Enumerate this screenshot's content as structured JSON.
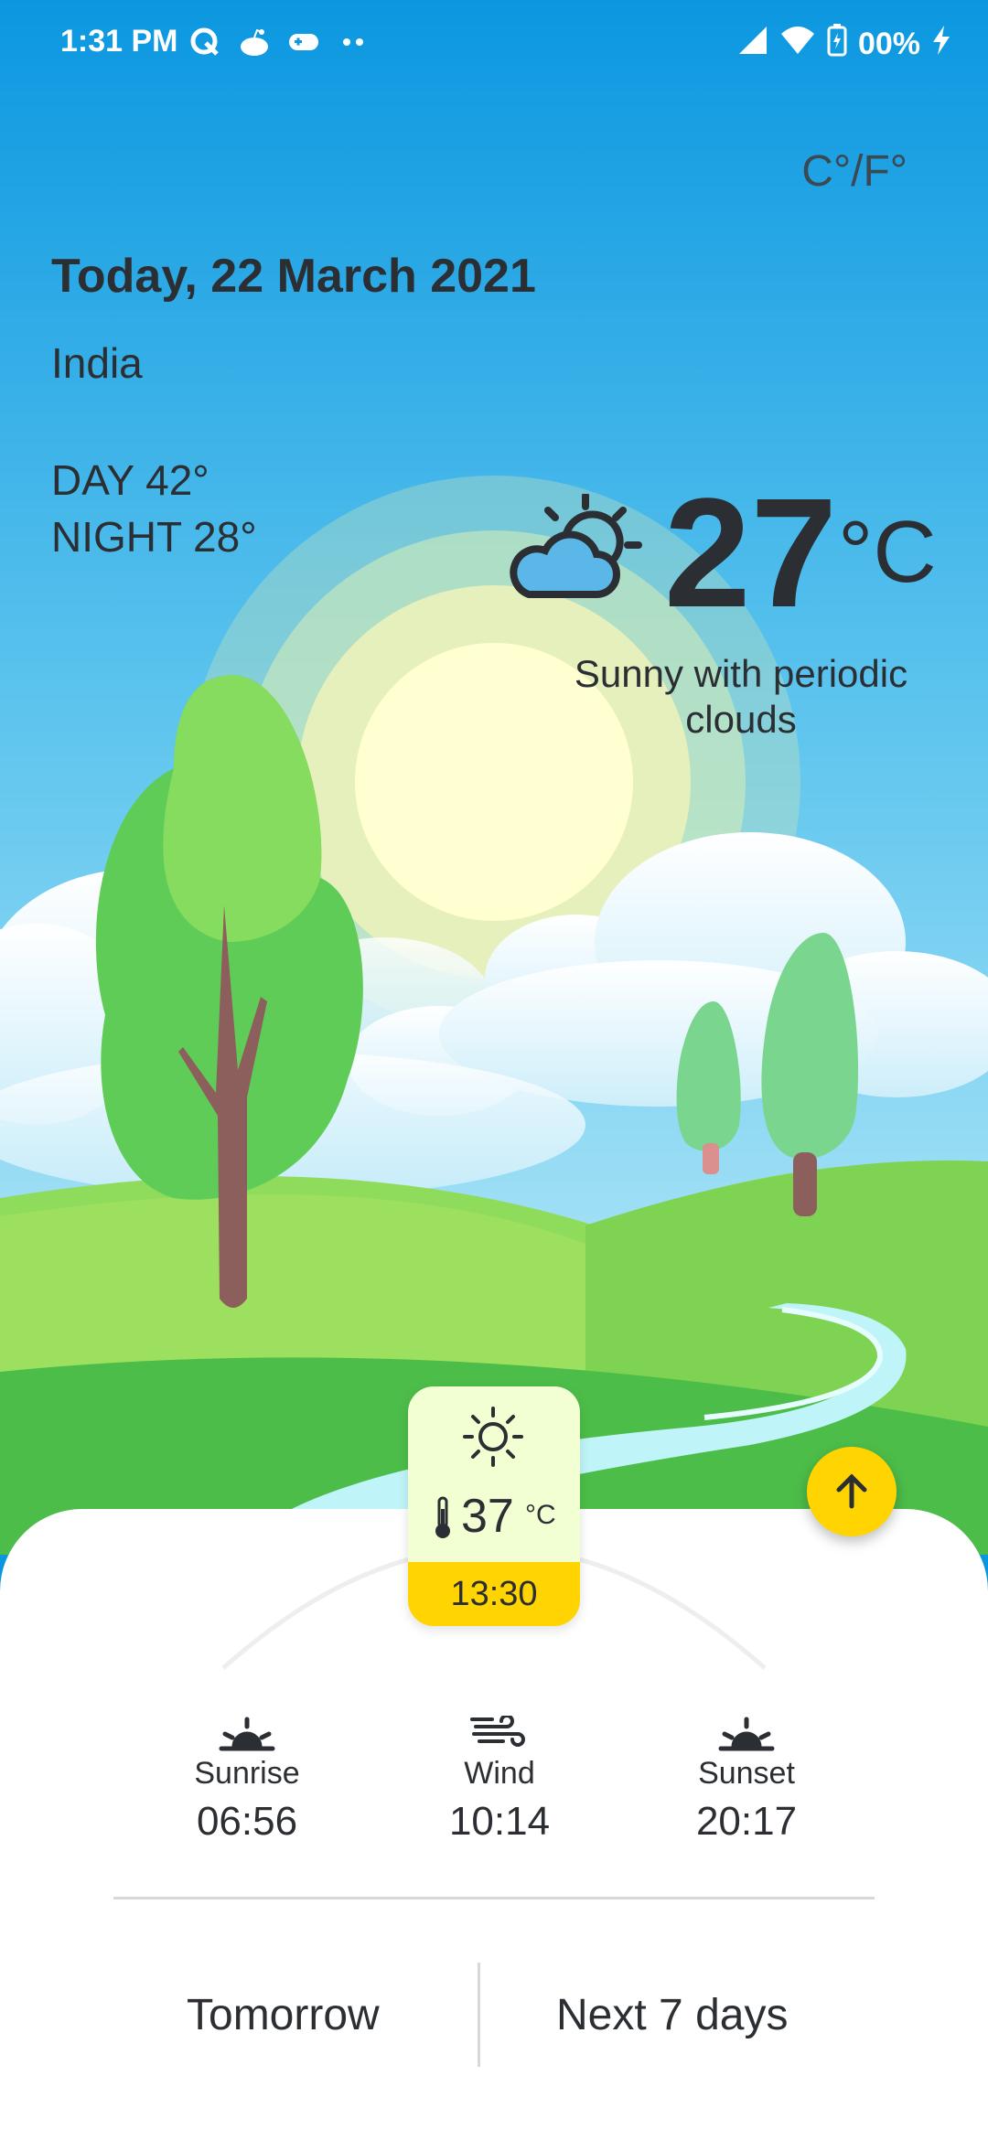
{
  "status_bar": {
    "time": "1:31 PM",
    "battery": "00%",
    "icons": [
      "q-app-icon",
      "reddit-icon",
      "game-controller-icon",
      "more-dots-icon",
      "signal-icon",
      "wifi-icon",
      "battery-icon",
      "charging-icon"
    ]
  },
  "header": {
    "unit_toggle": "C°/F°",
    "date": "Today, 22 March 2021",
    "location": "India",
    "day_temp": "DAY 42°",
    "night_temp": "NIGHT 28°"
  },
  "current": {
    "temperature": "27",
    "unit": "°C",
    "condition": "Sunny with periodic clouds",
    "condition_icon": "partly-cloudy-icon"
  },
  "hourly_card": {
    "icon": "sun-icon",
    "temperature": "37",
    "unit": "°C",
    "time": "13:30"
  },
  "fab": {
    "icon": "arrow-up-icon"
  },
  "stats": [
    {
      "label": "Sunrise",
      "value": "06:56",
      "icon": "sunrise-icon"
    },
    {
      "label": "Wind",
      "value": "10:14",
      "icon": "wind-icon"
    },
    {
      "label": "Sunset",
      "value": "20:17",
      "icon": "sunset-icon"
    }
  ],
  "tabs": {
    "tomorrow": "Tomorrow",
    "next7": "Next 7 days"
  },
  "colors": {
    "sky_top": "#0b97e0",
    "sky_bottom": "#8fd8f4",
    "accent": "#ffd400",
    "text": "#2b2f33",
    "card_bg": "#f1ffd2"
  }
}
